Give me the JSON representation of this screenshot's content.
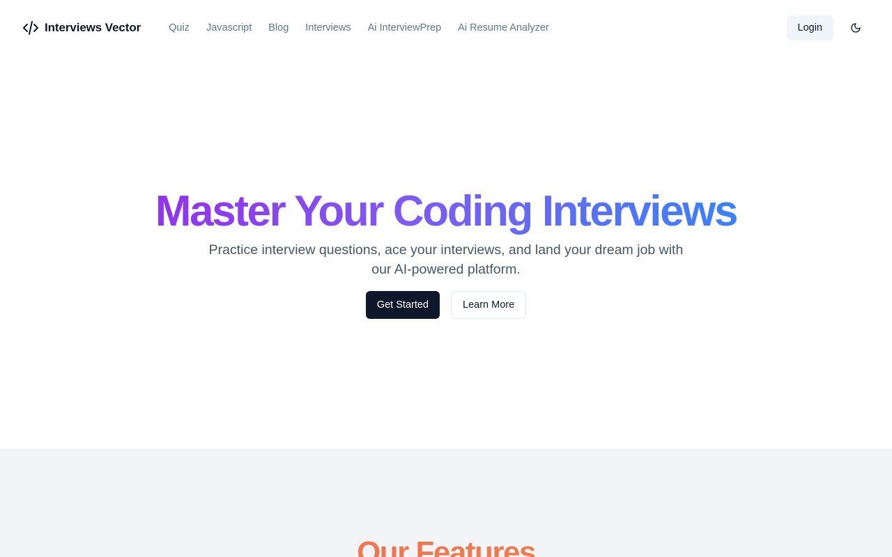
{
  "header": {
    "brand_name": "Interviews Vector",
    "brand_icon": "code-icon",
    "nav": [
      {
        "label": "Quiz"
      },
      {
        "label": "Javascript"
      },
      {
        "label": "Blog"
      },
      {
        "label": "Interviews"
      },
      {
        "label": "Ai InterviewPrep"
      },
      {
        "label": "Ai Resume Analyzer"
      }
    ],
    "login_label": "Login",
    "theme_icon": "moon-icon"
  },
  "hero": {
    "title": "Master Your Coding Interviews",
    "subtitle": "Practice interview questions, ace your interviews, and land your dream job with our AI-powered platform.",
    "primary_label": "Get Started",
    "secondary_label": "Learn More"
  },
  "features": {
    "title": "Our Features"
  },
  "colors": {
    "title_gradient_start": "#9333ea",
    "title_gradient_end": "#3b82f6",
    "features_gradient_start": "#e86a5a",
    "features_gradient_end": "#f08a4a",
    "primary_button": "#0f172a",
    "features_background": "#f3f4f6"
  }
}
